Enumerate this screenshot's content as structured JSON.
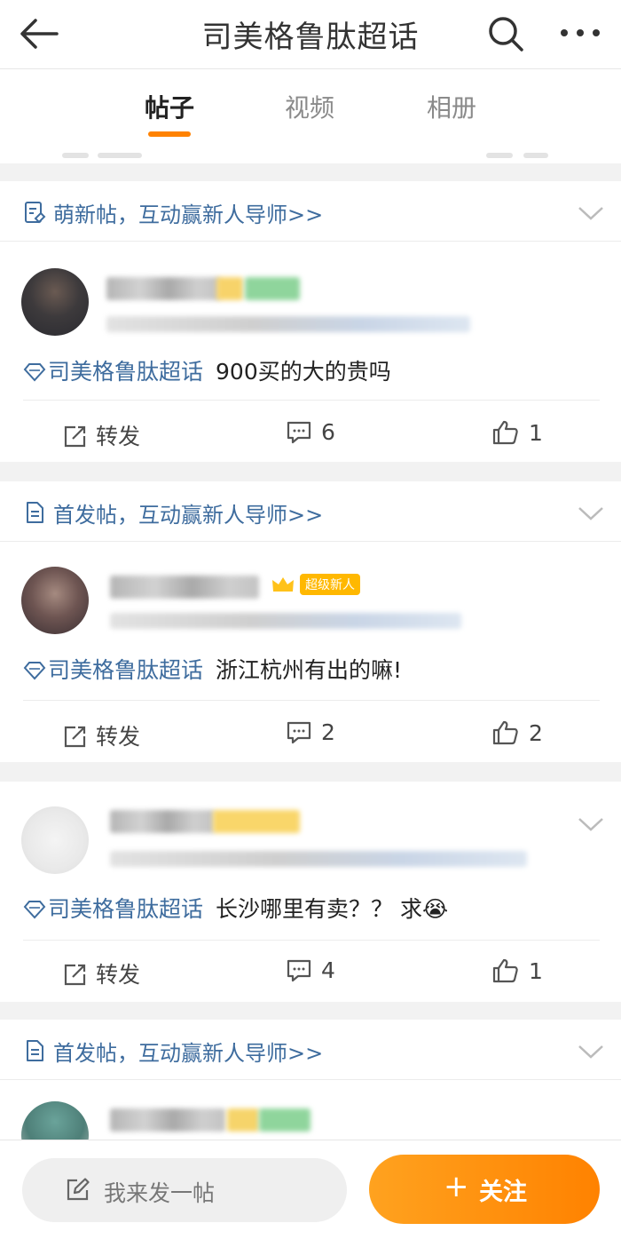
{
  "header": {
    "title": "司美格鲁肽超话",
    "back_icon": "arrow-left-icon",
    "search_icon": "search-icon",
    "more_icon": "more-horizontal-icon"
  },
  "tabs": [
    {
      "label": "帖子",
      "active": true
    },
    {
      "label": "视频",
      "active": false
    },
    {
      "label": "相册",
      "active": false
    }
  ],
  "accent_color": "#ff8200",
  "link_color": "#3e6c9e",
  "posts": [
    {
      "header": "萌新帖，互动赢新人导师>>",
      "topic": "司美格鲁肽超话",
      "text": "900买的大的贵吗",
      "repost_label": "转发",
      "comments": "6",
      "likes": "1"
    },
    {
      "header": "首发帖，互动赢新人导师>>",
      "badge": "超级新人",
      "topic": "司美格鲁肽超话",
      "text": "浙江杭州有出的嘛!",
      "repost_label": "转发",
      "comments": "2",
      "likes": "2"
    },
    {
      "topic": "司美格鲁肽超话",
      "text": "长沙哪里有卖？？ 求😭",
      "repost_label": "转发",
      "comments": "4",
      "likes": "1"
    },
    {
      "header": "首发帖，互动赢新人导师>>"
    }
  ],
  "bottom": {
    "post_placeholder": "我来发一帖",
    "follow_plus": "+",
    "follow_label": "关注"
  }
}
